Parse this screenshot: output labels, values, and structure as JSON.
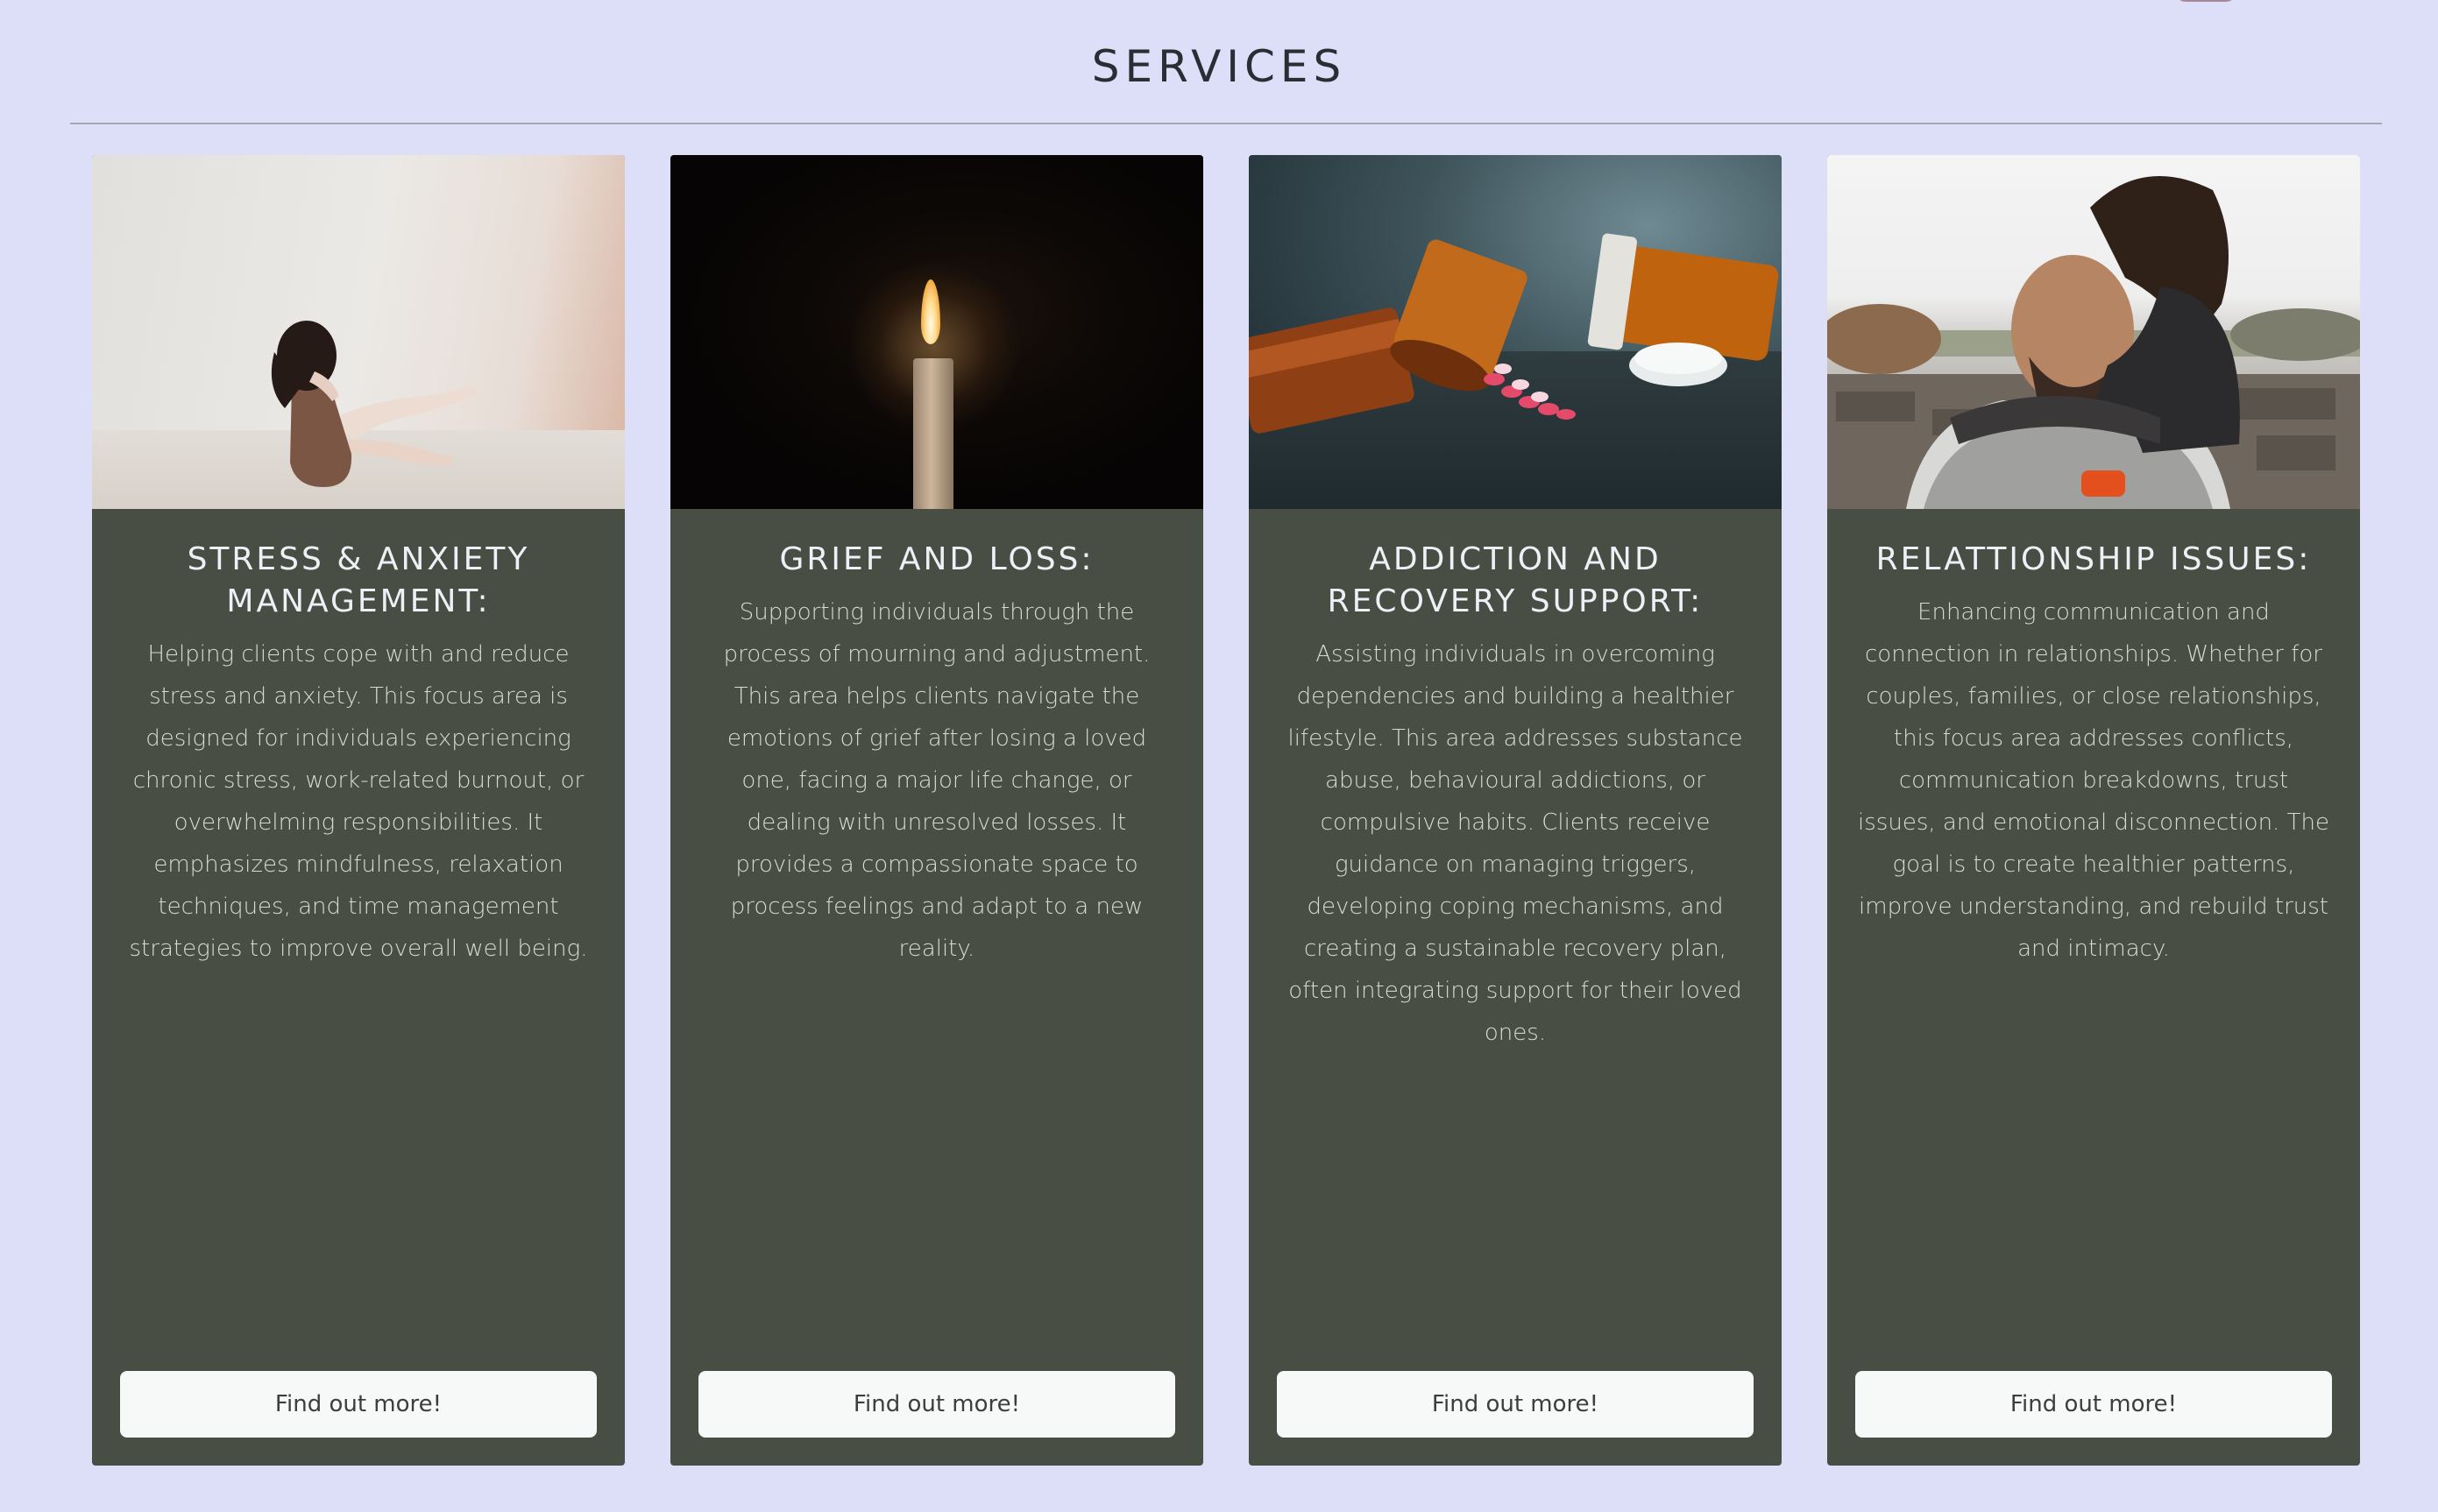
{
  "page": {
    "title": "SERVICES"
  },
  "cards": [
    {
      "title": "STRESS & ANXIETY MANAGEMENT:",
      "description": "Helping clients cope with and reduce stress and anxiety. This focus area is designed for individuals experiencing chronic stress, work-related burnout, or overwhelming responsibilities. It emphasizes mindfulness, relaxation techniques, and time management strategies to improve overall well being.",
      "button_label": "Find out more!"
    },
    {
      "title": "GRIEF AND LOSS:",
      "description": "Supporting individuals through the process of mourning and adjustment. This area helps clients navigate the emotions of grief after losing a loved one, facing a major life change, or dealing with unresolved losses. It provides a compassionate space to process feelings and adapt to a new reality.",
      "button_label": "Find out more!"
    },
    {
      "title": "ADDICTION AND RECOVERY SUPPORT:",
      "description": "Assisting individuals in overcoming dependencies and building a healthier lifestyle. This area addresses substance abuse, behavioural addictions, or compulsive habits. Clients receive guidance on managing triggers, developing coping mechanisms, and creating a sustainable recovery plan, often integrating support for their loved ones.",
      "button_label": "Find out more!"
    },
    {
      "title": "RELATTIONSHIP ISSUES:",
      "description": "Enhancing communication and connection in relationships. Whether for couples, families, or close relationships, this focus area addresses conflicts, communication breakdowns, trust issues, and emotional disconnection. The goal is to create healthier patterns, improve understanding, and rebuild trust and intimacy.",
      "button_label": "Find out more!"
    }
  ],
  "colors": {
    "background": "#dcdff7",
    "card": "#494e44",
    "button": "#f7f9f8"
  }
}
